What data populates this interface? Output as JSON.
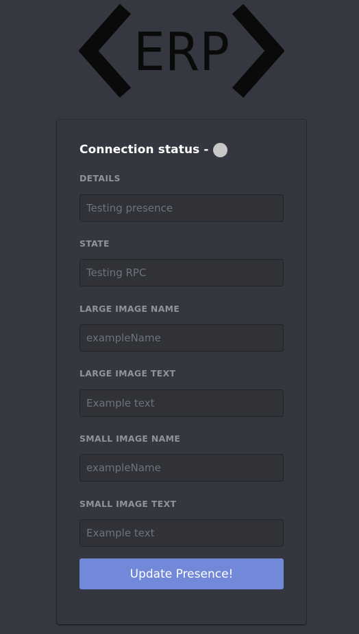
{
  "logo": {
    "text": "ERP"
  },
  "status": {
    "label": "Connection status -",
    "dot_color": "#c8c8c8"
  },
  "fields": [
    {
      "label": "DETAILS",
      "placeholder": "Testing presence"
    },
    {
      "label": "STATE",
      "placeholder": "Testing RPC"
    },
    {
      "label": "LARGE IMAGE NAME",
      "placeholder": "exampleName"
    },
    {
      "label": "LARGE IMAGE TEXT",
      "placeholder": "Example text"
    },
    {
      "label": "SMALL IMAGE NAME",
      "placeholder": "exampleName"
    },
    {
      "label": "SMALL IMAGE TEXT",
      "placeholder": "Example text"
    }
  ],
  "button": {
    "label": "Update Presence!",
    "color": "#7289da"
  },
  "colors": {
    "background": "#353840",
    "card": "#34373f",
    "input_background": "#303237",
    "label": "#8f939b"
  }
}
